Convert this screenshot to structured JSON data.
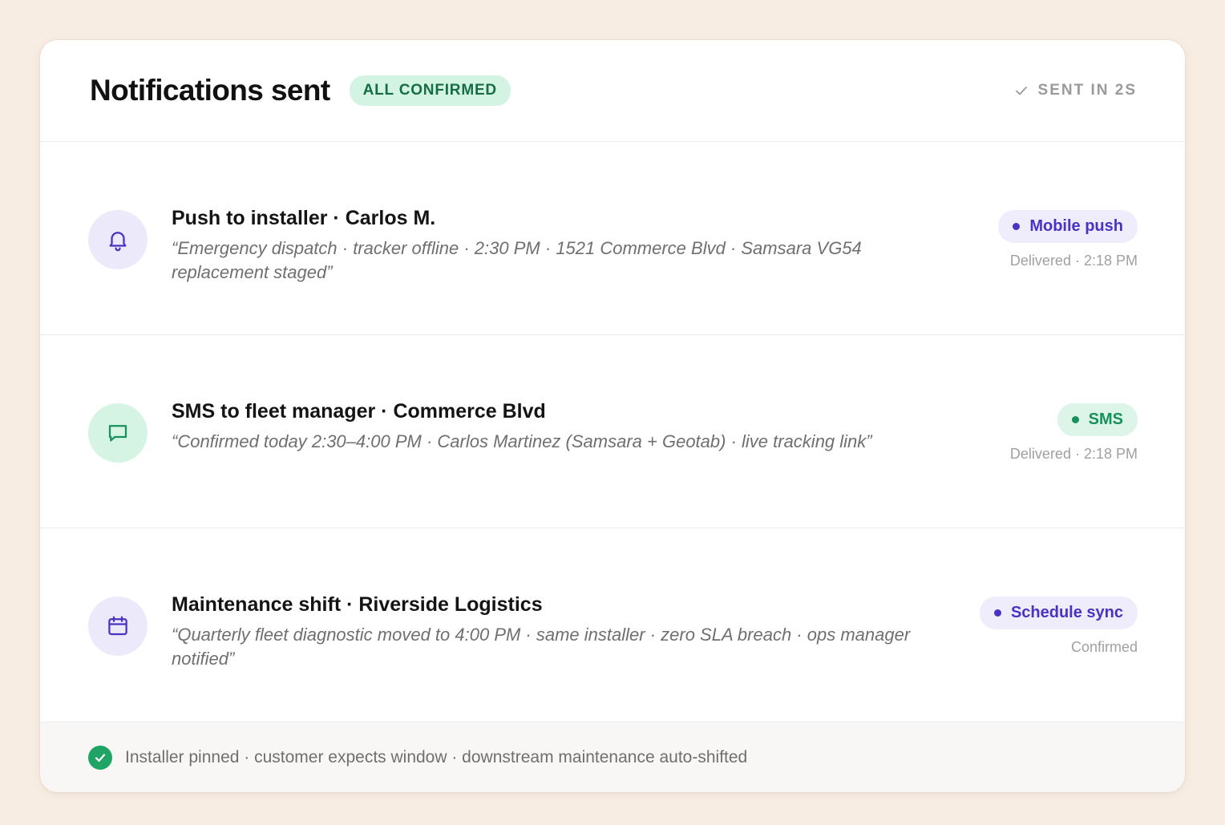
{
  "header": {
    "title": "Notifications sent",
    "badge": "ALL CONFIRMED",
    "sent_status": "SENT IN 2S"
  },
  "notifications": [
    {
      "icon": "bell-icon",
      "title": "Push to installer · Carlos M.",
      "description": "“Emergency dispatch · tracker offline · 2:30 PM · 1521 Commerce Blvd · Samsara VG54 replacement staged”",
      "channel": "Mobile push",
      "status": "Delivered · 2:18 PM"
    },
    {
      "icon": "message-icon",
      "title": "SMS to fleet manager · Commerce Blvd",
      "description": "“Confirmed today 2:30–4:00 PM · Carlos Martinez (Samsara + Geotab) · live tracking link”",
      "channel": "SMS",
      "status": "Delivered · 2:18 PM"
    },
    {
      "icon": "calendar-icon",
      "title": "Maintenance shift · Riverside Logistics",
      "description": "“Quarterly fleet diagnostic moved to 4:00 PM · same installer · zero SLA breach · ops manager notified”",
      "channel": "Schedule sync",
      "status": "Confirmed"
    }
  ],
  "footer": {
    "text": "Installer pinned · customer expects window · downstream maintenance auto-shifted"
  },
  "colors": {
    "background": "#f8ede3",
    "violet_accent": "#4a33c4",
    "green_accent": "#16915a",
    "success": "#1fa466"
  }
}
